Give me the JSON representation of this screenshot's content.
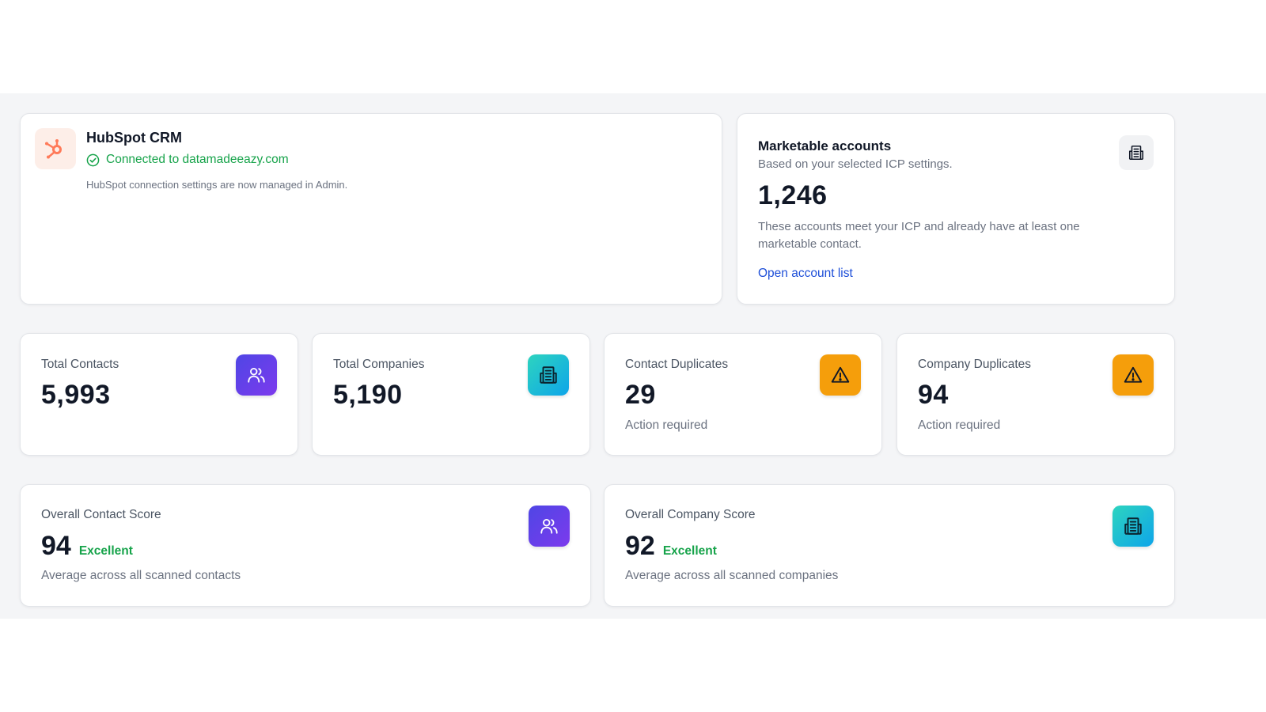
{
  "hubspot": {
    "title": "HubSpot CRM",
    "status": "Connected to datamadeeazy.com",
    "note": "HubSpot connection settings are now managed in Admin.",
    "status_color": "#16a34a",
    "logo_color": "#ff7a59"
  },
  "marketable": {
    "title": "Marketable accounts",
    "subtitle": "Based on your selected ICP settings.",
    "value": "1,246",
    "description": "These accounts meet your ICP and already have at least one marketable contact.",
    "link_label": "Open account list",
    "icon": "building-icon"
  },
  "stats": [
    {
      "label": "Total Contacts",
      "value": "5,993",
      "note": "",
      "icon": "users-icon",
      "color": "#5b4ae6"
    },
    {
      "label": "Total Companies",
      "value": "5,190",
      "note": "",
      "icon": "building-icon",
      "color": "#19b8d6"
    },
    {
      "label": "Contact Duplicates",
      "value": "29",
      "note": "Action required",
      "icon": "warning-icon",
      "color": "#f59e0b"
    },
    {
      "label": "Company Duplicates",
      "value": "94",
      "note": "Action required",
      "icon": "warning-icon",
      "color": "#f59e0b"
    }
  ],
  "scores": [
    {
      "label": "Overall Contact Score",
      "value": "94",
      "badge": "Excellent",
      "note": "Average across all scanned contacts",
      "icon": "users-icon"
    },
    {
      "label": "Overall Company Score",
      "value": "92",
      "badge": "Excellent",
      "note": "Average across all scanned companies",
      "icon": "building-icon"
    }
  ],
  "colors": {
    "accent_link": "#1d4ed8",
    "success": "#16a34a",
    "warning": "#f59e0b",
    "purple": "#5b4ae6",
    "teal": "#19b8d6"
  }
}
